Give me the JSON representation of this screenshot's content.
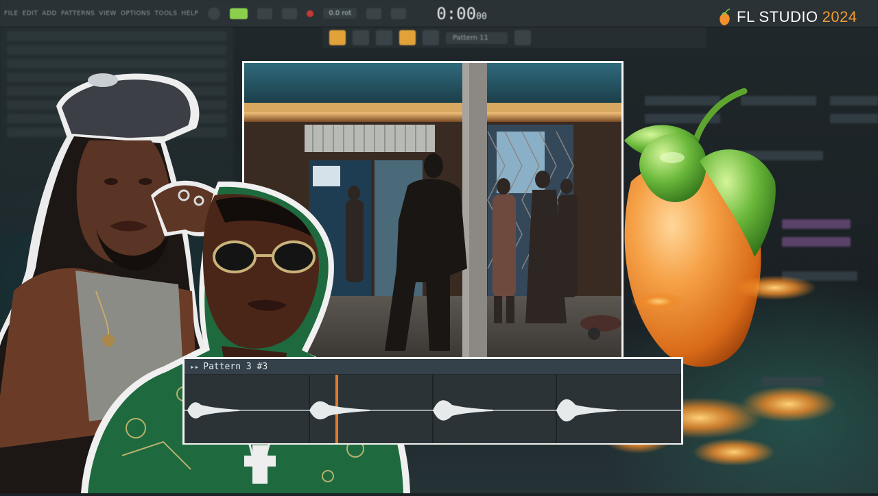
{
  "app": {
    "brand_name": "FL STUDIO",
    "brand_year": "2024"
  },
  "toolbar": {
    "menu_items": [
      "FILE",
      "EDIT",
      "ADD",
      "PATTERNS",
      "VIEW",
      "OPTIONS",
      "TOOLS",
      "HELP"
    ],
    "tempo": "0.0 rot",
    "clock_main": "0:00",
    "clock_sub": "00",
    "pattern_select": "Pattern 11"
  },
  "pattern_clip": {
    "title": "Pattern 3 #3",
    "arrow": "▸▸"
  },
  "colors": {
    "accent_orange": "#f29a2e",
    "fl_green": "#8ccf4c",
    "playhead": "#e07a2a",
    "border": "#f4f4f4"
  },
  "icons": {
    "brand": "fl-fruit-icon",
    "record": "record-dot-icon",
    "play": "play-icon"
  }
}
